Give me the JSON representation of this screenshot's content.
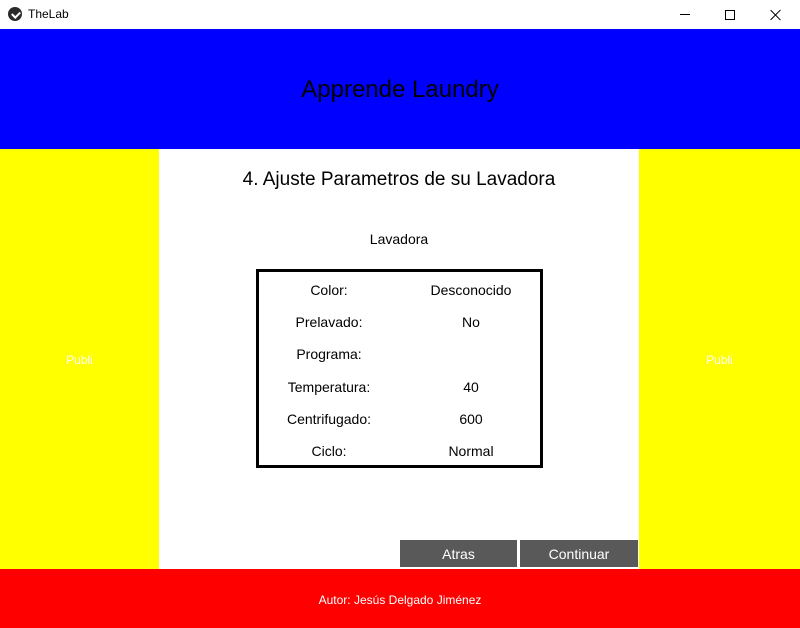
{
  "window": {
    "title": "TheLab",
    "icon": "app-logo-icon",
    "controls": [
      "minimize-icon",
      "maximize-icon",
      "close-icon"
    ]
  },
  "colors": {
    "header_bg": "#0000ff",
    "side_bg": "#ffff00",
    "footer_bg": "#ff0000",
    "button_bg": "#595959"
  },
  "header": {
    "title": "Apprende Laundry"
  },
  "sidebar_left": {
    "label": "Publi"
  },
  "sidebar_right": {
    "label": "Publi"
  },
  "main": {
    "section_title": "4. Ajuste Parametros de su Lavadora",
    "machine_label": "Lavadora",
    "params": [
      {
        "label": "Color:",
        "value": "Desconocido"
      },
      {
        "label": "Prelavado:",
        "value": "No"
      },
      {
        "label": "Programa:",
        "value": ""
      },
      {
        "label": "Temperatura:",
        "value": "40"
      },
      {
        "label": "Centrifugado:",
        "value": "600"
      },
      {
        "label": "Ciclo:",
        "value": "Normal"
      }
    ],
    "buttons": {
      "back": "Atras",
      "continue": "Continuar"
    }
  },
  "footer": {
    "author": "Autor: Jesús Delgado Jiménez"
  }
}
